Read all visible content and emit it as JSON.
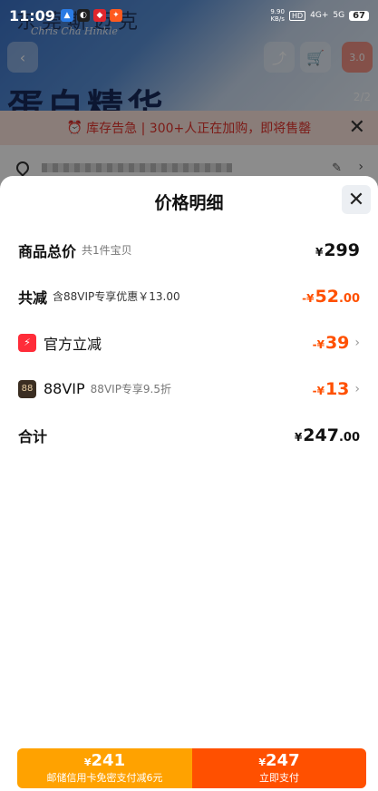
{
  "status_bar": {
    "time": "11:09",
    "net_speed": "9.90\nKB/s",
    "hd": "HD",
    "sig1": "4G+",
    "sig2": "5G",
    "battery": "67"
  },
  "background": {
    "brand": "东莞斯迈克",
    "brand_sub": "Chris Cha Hinkle",
    "hero_title": "蛋白精华",
    "page_indicator": "2/2",
    "more_label": "3.0",
    "alert_text": "库存告急 | 300+人正在加购，即将售罄"
  },
  "sheet": {
    "title": "价格明细",
    "rows": [
      {
        "label": "商品总价",
        "sub": "共1件宝贝",
        "yen": "¥",
        "int": "299",
        "dec": ""
      },
      {
        "label": "共减",
        "sub": "含88VIP专享优惠￥13.00",
        "yen": "-¥",
        "int": "52",
        "dec": ".00"
      },
      {
        "label": "官方立减",
        "sub": "",
        "yen": "-¥",
        "int": "39",
        "dec": ""
      },
      {
        "label": "88VIP",
        "badge": "88",
        "sub": "88VIP专享9.5折",
        "yen": "-¥",
        "int": "13",
        "dec": ""
      },
      {
        "label": "合计",
        "sub": "",
        "yen": "¥",
        "int": "247",
        "dec": ".00"
      }
    ]
  },
  "footer": {
    "left_yen": "¥",
    "left_price": "241",
    "left_desc": "邮储信用卡免密支付减6元",
    "right_yen": "¥",
    "right_price": "247",
    "right_desc": "立即支付"
  },
  "colors": {
    "accent_orange": "#ff5000",
    "secondary_orange": "#ffa200"
  }
}
